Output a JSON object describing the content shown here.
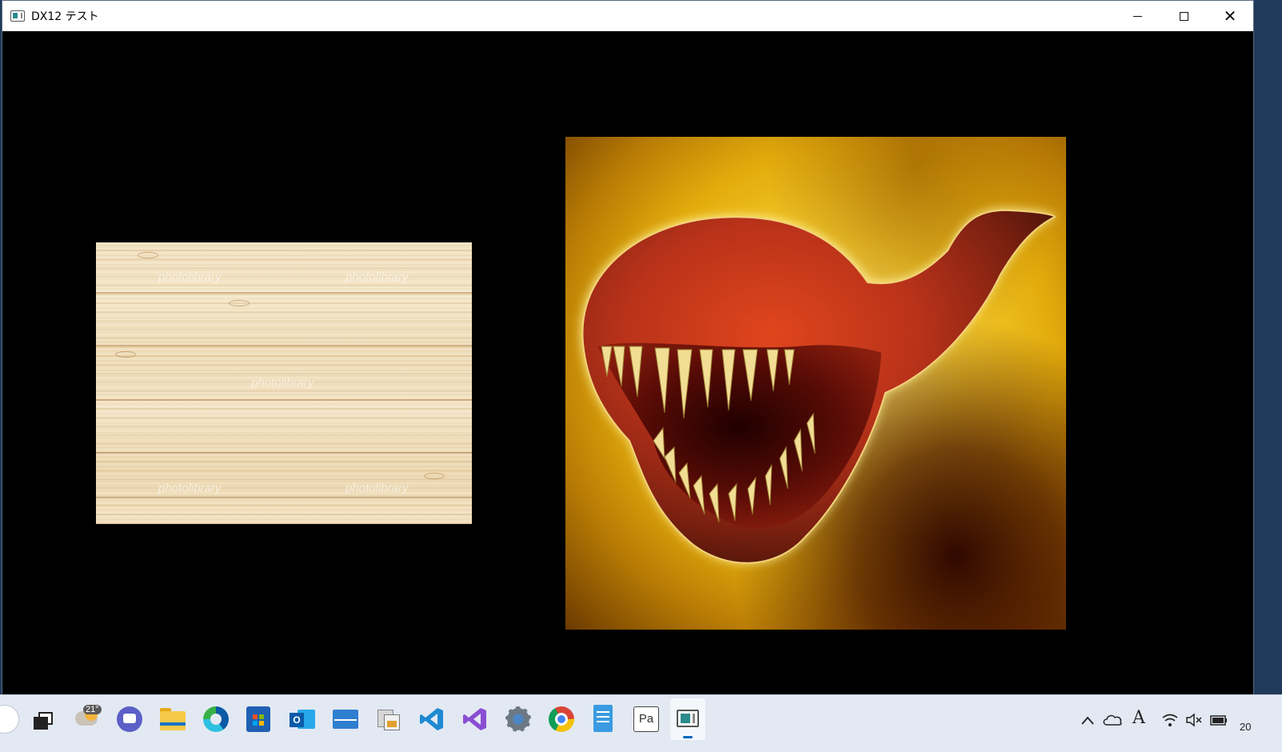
{
  "window": {
    "title": "DX12 テスト",
    "controls": {
      "minimize": "minimize",
      "maximize": "maximize",
      "close": "close"
    }
  },
  "viewport": {
    "background": "#000000",
    "quads": [
      {
        "name": "wood-texture",
        "watermark": "photolibrary"
      },
      {
        "name": "monster-texture"
      }
    ]
  },
  "taskbar": {
    "weather": {
      "temp": "21°"
    },
    "clock_partial": "20",
    "pinned": [
      "start",
      "task-view",
      "weather",
      "teams-chat",
      "file-explorer",
      "edge",
      "microsoft-store",
      "outlook",
      "mail",
      "photos",
      "vs-code",
      "visual-studio",
      "settings",
      "chrome",
      "notepad",
      "paint-shop",
      "dx12-app"
    ],
    "tray": [
      "chevron-up",
      "onedrive",
      "ime-a",
      "wifi",
      "volume-muted",
      "battery"
    ]
  },
  "colors": {
    "taskbar_bg": "#e3e9f3",
    "titlebar_bg": "#ffffff",
    "accent": "#0067c0"
  }
}
